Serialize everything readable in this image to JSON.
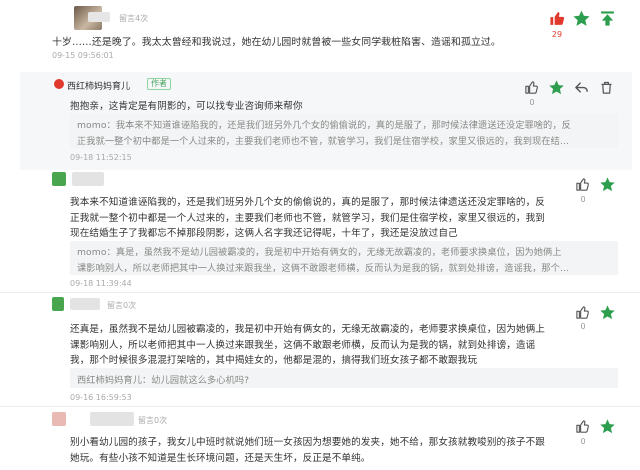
{
  "colors": {
    "green": "#2d9e4d",
    "red": "#e03a2e",
    "text": "#333333",
    "meta": "#aaaaaa",
    "name_red": "#d9534f"
  },
  "c1": {
    "meta": "留言4次",
    "lines": [
      "十岁……还是晚了。我太太曾经和我说过，她在幼儿园时就曾被一些女同学栽桩陷害、造谣和孤立过。"
    ],
    "date": "09-15 09:56:01",
    "likes": "29"
  },
  "c2": {
    "name": "西红柿妈妈育儿",
    "tag": "作者",
    "lines": [
      "抱抱亲，这肯定是有阴影的，可以找专业咨询师来帮你"
    ],
    "quote": [
      "momo：我本来不知道谁诬陷我的，还是我们班另外几个女的偷偷说的，真的是服了，那时候法律遗送还没定罪啥的，反",
      "正我就一整个初中都是一个人过来的，主要我们老师也不管，就管学习，我们是住宿学校，家里又很远的，我到现在结..."
    ],
    "date": "09-18 11:52:15",
    "likes": "0"
  },
  "c3": {
    "lines": [
      "我本来不知道谁诬陷我的，还是我们班另外几个女的偷偷说的，真的是服了，那时候法律遗送还没定罪啥的，反",
      "正我就一整个初中都是一个人过来的，主要我们老师也不管，就管学习，我们是住宿学校，家里又很远的，我到",
      "现在结婚生子了我都忘不掉那段阴影，这俩人名字我还记得呢，十年了，我还是没放过自己"
    ],
    "quote": [
      "momo：真是，虽然我不是幼儿园被霸凌的，我是初中开始有俩女的，无缘无故霸凌的，老师要求换桌位，因为她俩上",
      "课影响别人，所以老师把其中一人换过来跟我坐，这俩不敢跟老师横，反而认为是我的锅，就到处排谤，造谣我，那个..."
    ],
    "date": "09-18 11:39:44",
    "likes": "0"
  },
  "c4": {
    "meta": "留言0次",
    "lines": [
      "还真是，虽然我不是幼儿园被霸凌的，我是初中开始有俩女的，无缘无故霸凌的，老师要求换桌位，因为她俩上",
      "课影响别人，所以老师把其中一人换过来跟我坐，这俩不敢跟老师横，反而认为是我的锅，就到处排谤，造谣",
      "我，那个时候很多混混打架啥的，其中揭娃女的，他都是混的，搞得我们班女孩子都不敢跟我玩"
    ],
    "quote": [
      "西红柿妈妈育儿：幼儿园就这么多心机吗?"
    ],
    "date": "09-16 16:59:53",
    "likes": "0"
  },
  "c5": {
    "meta": "留言0次",
    "lines": [
      "别小看幼儿园的孩子，我女儿中班时就说她们班一女孩因为想要她的发夹，她不给，那女孩就教唆别的孩子不跟",
      "她玩。有些小孩不知道是生长环境问题，还是天生坏，反正是不单纯。"
    ],
    "likes": "0"
  }
}
